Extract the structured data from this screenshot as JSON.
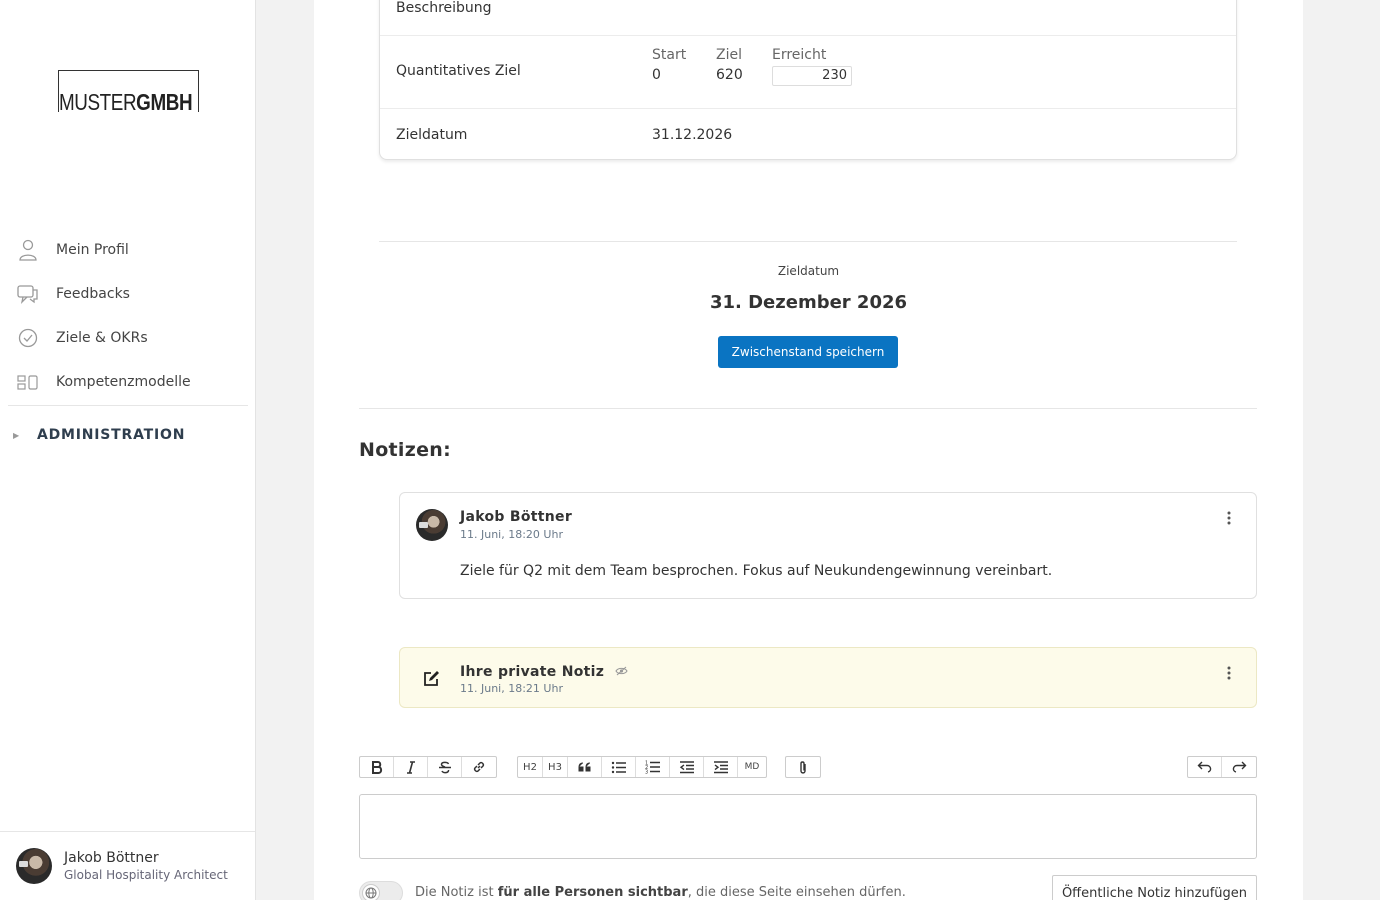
{
  "brand": {
    "logo_light": "MUSTER",
    "logo_bold": "GMBH"
  },
  "sidebar": {
    "items": [
      {
        "label": "Mein Profil",
        "icon": "user-icon"
      },
      {
        "label": "Feedbacks",
        "icon": "chat-icon"
      },
      {
        "label": "Ziele & OKRs",
        "icon": "check-circle-icon"
      },
      {
        "label": "Kompetenzmodelle",
        "icon": "grid-icon"
      }
    ],
    "admin_label": "ADMINISTRATION"
  },
  "user": {
    "name": "Jakob Böttner",
    "role": "Global Hospitality Architect"
  },
  "goal_card": {
    "description_label": "Beschreibung",
    "quant_label": "Quantitatives Ziel",
    "start_label": "Start",
    "start_value": "0",
    "target_label": "Ziel",
    "target_value": "620",
    "reached_label": "Erreicht",
    "reached_value": "230",
    "date_label": "Zieldatum",
    "date_value": "31.12.2026"
  },
  "target_date": {
    "label": "Zieldatum",
    "value": "31. Dezember 2026"
  },
  "save_button": "Zwischenstand speichern",
  "notes": {
    "title": "Notizen:",
    "items": [
      {
        "author": "Jakob Böttner",
        "time": "11. Juni, 18:20 Uhr",
        "text": "Ziele für Q2 mit dem Team besprochen. Fokus auf Neukundengewinnung vereinbart."
      },
      {
        "author": "Ihre private Notiz",
        "time": "11. Juni, 18:21 Uhr",
        "text": ""
      }
    ]
  },
  "toolbar": {
    "h2": "H2",
    "h3": "H3",
    "md": "MD"
  },
  "visibility": {
    "prefix": "Die Notiz ist ",
    "bold": "für alle Personen sichtbar",
    "suffix": ", die diese Seite einsehen dürfen."
  },
  "public_button": "Öffentliche Notiz hinzufügen",
  "colors": {
    "accent": "#0a74c2",
    "private_note_bg": "#fdfbea"
  }
}
